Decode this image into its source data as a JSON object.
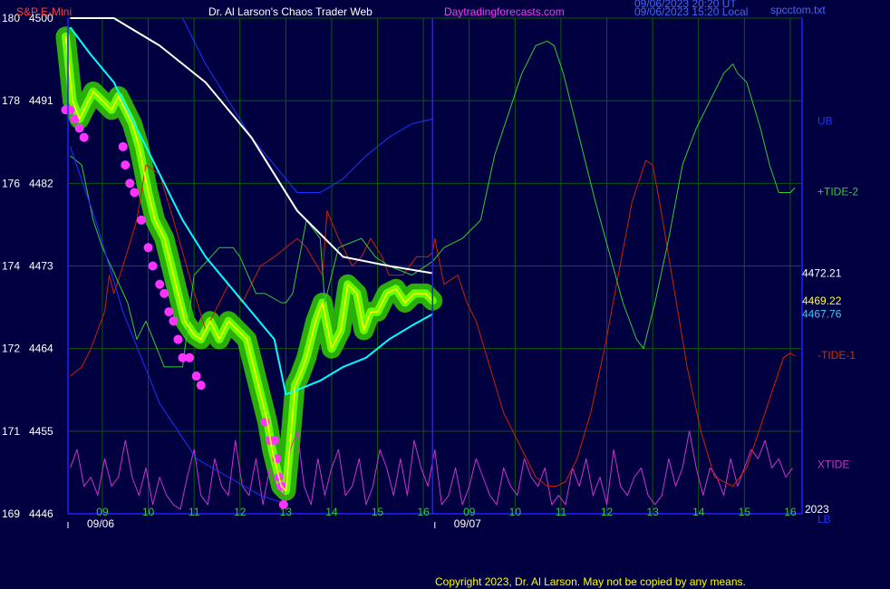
{
  "header": {
    "title_left": "S&P E-Mini",
    "title_center": "Dr. Al Larson's Chaos Trader Web",
    "title_site": "Daytradingforecasts.com",
    "timestamp_1": "09/06/2023 20:20 UT",
    "timestamp_2": "09/06/2023 15:20 Local",
    "file_name": "spcctom.txt"
  },
  "footer": {
    "copyright": "Copyright 2023, Dr. Al Larson. May not be copied by any means.",
    "year": "2023"
  },
  "colors": {
    "background": "#000040",
    "grid": "#0a5a0a",
    "axis": "#2020ff",
    "price": "#ffff00",
    "bands": "#00ffff",
    "glow": "#33cc00",
    "dots": "#ff33ff",
    "tide_plus": "#33cc33",
    "tide_minus": "#cc2200",
    "xtide": "#cc33cc",
    "ma_white": "#ffffff",
    "upper_band": "#1a33ff"
  },
  "chart_data": {
    "type": "line",
    "title": "S&P E-Mini",
    "y_axis": {
      "ticks": [
        {
          "left": "180",
          "right": "4500",
          "value": 4500
        },
        {
          "left": "178",
          "right": "4491",
          "value": 4491
        },
        {
          "left": "176",
          "right": "4482",
          "value": 4482
        },
        {
          "left": "174",
          "right": "4473",
          "value": 4473
        },
        {
          "left": "172",
          "right": "4464",
          "value": 4464
        },
        {
          "left": "171",
          "right": "4455",
          "value": 4455
        },
        {
          "left": "169",
          "right": "4446",
          "value": 4446
        }
      ],
      "ylim": [
        4446,
        4500
      ]
    },
    "x_axis": {
      "hour_ticks": [
        {
          "label": "09",
          "t": 0.75
        },
        {
          "label": "10",
          "t": 1.75
        },
        {
          "label": "11",
          "t": 2.75
        },
        {
          "label": "12",
          "t": 3.75
        },
        {
          "label": "13",
          "t": 4.75
        },
        {
          "label": "14",
          "t": 5.75
        },
        {
          "label": "15",
          "t": 6.75
        },
        {
          "label": "16",
          "t": 7.75
        },
        {
          "label": "09",
          "t": 8.75
        },
        {
          "label": "10",
          "t": 9.75
        },
        {
          "label": "11",
          "t": 10.75
        },
        {
          "label": "12",
          "t": 11.75
        },
        {
          "label": "13",
          "t": 12.75
        },
        {
          "label": "14",
          "t": 13.75
        },
        {
          "label": "15",
          "t": 14.75
        },
        {
          "label": "16",
          "t": 15.75
        }
      ],
      "date_labels": [
        {
          "label": "09/06",
          "t": 0
        },
        {
          "label": "09/07",
          "t": 8
        }
      ],
      "xlim": [
        0,
        15.85
      ],
      "now_t": 7.95
    },
    "value_labels": [
      {
        "text": "4472.21",
        "value": 4472.21,
        "color": "#ffffff"
      },
      {
        "text": "4469.22",
        "value": 4469.22,
        "color": "#ffff33"
      },
      {
        "text": "4467.76",
        "value": 4467.76,
        "color": "#33ccff"
      }
    ],
    "series_labels": [
      {
        "text": "UB",
        "value": 4488.8,
        "color": "#2233ff"
      },
      {
        "text": "+TIDE-2",
        "value": 4481.1,
        "color": "#33cc33"
      },
      {
        "text": "-TIDE-1",
        "value": 4463.3,
        "color": "#cc3300"
      },
      {
        "text": "XTIDE",
        "value": 4451.4,
        "color": "#cc33cc"
      },
      {
        "text": "LB",
        "value": 4445.4,
        "color": "#2233ff"
      }
    ],
    "series": [
      {
        "name": "Price",
        "color": "#ffff00",
        "glow": true,
        "t": [
          -0.05,
          0.1,
          0.25,
          0.4,
          0.55,
          0.75,
          0.95,
          1.1,
          1.25,
          1.4,
          1.55,
          1.75,
          1.9,
          2.0,
          2.1,
          2.25,
          2.4,
          2.55,
          2.75,
          2.9,
          3.1,
          3.3,
          3.5,
          3.7,
          3.9,
          4.05,
          4.2,
          4.35,
          4.45,
          4.55,
          4.65,
          4.75,
          4.85,
          4.95,
          5.05,
          5.2,
          5.4,
          5.55,
          5.75,
          5.95,
          6.1,
          6.3,
          6.45,
          6.6,
          6.75,
          6.95,
          7.15,
          7.35,
          7.55,
          7.8,
          7.95
        ],
        "y": [
          4498,
          4491,
          4489,
          4490.5,
          4492,
          4491,
          4490,
          4491.5,
          4490,
          4488.5,
          4486,
          4481,
          4478,
          4477,
          4476,
          4473,
          4470,
          4467,
          4465.5,
          4465,
          4467,
          4465,
          4467,
          4466,
          4465,
          4462,
          4459,
          4456,
          4453,
          4451,
          4449,
          4448.5,
          4454,
          4460,
          4461,
          4463,
          4467,
          4469,
          4464,
          4466,
          4471,
          4470,
          4466,
          4468,
          4468,
          4470,
          4470.5,
          4469,
          4470,
          4470,
          4469.22
        ]
      },
      {
        "name": "Band Average",
        "color": "#00ffff",
        "t": [
          0.05,
          0.5,
          1.0,
          1.5,
          2.0,
          2.5,
          3.0,
          3.5,
          4.0,
          4.5,
          4.75,
          5.0,
          5.5,
          6.0,
          6.5,
          7.0,
          7.5,
          7.95
        ],
        "y": [
          4499,
          4496,
          4493,
          4488,
          4483,
          4478,
          4474,
          4471,
          4468,
          4465,
          4459,
          4459.5,
          4460.5,
          4462,
          4463,
          4465,
          4466.5,
          4467.76
        ]
      },
      {
        "name": "MA",
        "color": "#ffffff",
        "t": [
          0.05,
          1.0,
          2.0,
          3.0,
          4.0,
          5.0,
          6.0,
          7.0,
          7.95
        ],
        "y": [
          4500,
          4500,
          4497,
          4493,
          4487,
          4479,
          4474,
          4473,
          4472.21
        ]
      },
      {
        "name": "UB",
        "color": "#1a33ff",
        "t": [
          2.5,
          3.0,
          3.5,
          4.0,
          4.5,
          5.0,
          5.5,
          6.0,
          6.5,
          7.0,
          7.5,
          7.95
        ],
        "y": [
          4500,
          4495,
          4491,
          4487,
          4484,
          4481,
          4481,
          4482.5,
          4485,
          4487,
          4488.5,
          4489
        ]
      },
      {
        "name": "LB",
        "color": "#1a33ff",
        "t": [
          0.05,
          0.6,
          1.2,
          2.0,
          2.8,
          3.5,
          4.2,
          4.8
        ],
        "y": [
          4486,
          4478,
          4468,
          4458,
          4452,
          4450,
          4448,
          4447
        ]
      },
      {
        "name": "+TIDE-2",
        "color": "#33cc33",
        "t": [
          0.05,
          0.3,
          0.55,
          0.75,
          1.3,
          1.5,
          1.7,
          2.1,
          2.3,
          2.5,
          2.75,
          3.3,
          3.6,
          3.75,
          4.1,
          4.3,
          4.65,
          4.75,
          4.9,
          5.2,
          5.5,
          5.6,
          5.9,
          6.4,
          6.7,
          7.0,
          7.5,
          7.8,
          7.95,
          8.2,
          8.6,
          9.0,
          9.3,
          9.9,
          10.2,
          10.45,
          10.6,
          10.8,
          11.0,
          11.2,
          11.5,
          12.1,
          12.4,
          12.55,
          12.8,
          13.1,
          13.4,
          13.7,
          13.9,
          14.1,
          14.3,
          14.5,
          14.6,
          14.8,
          15.1,
          15.3,
          15.5,
          15.75,
          15.85
        ],
        "y": [
          4485,
          4484,
          4478,
          4475,
          4469,
          4465,
          4467,
          4462,
          4462,
          4462,
          4472,
          4475,
          4475,
          4474,
          4470,
          4470,
          4469,
          4469,
          4470,
          4478,
          4476,
          4469,
          4475,
          4476,
          4474,
          4473,
          4472,
          4473,
          4473.5,
          4475,
          4476,
          4478,
          4485,
          4494,
          4497,
          4497.5,
          4497,
          4494,
          4490,
          4486,
          4480,
          4469,
          4465,
          4464,
          4469,
          4476,
          4484,
          4488,
          4490,
          4492,
          4494,
          4495,
          4494,
          4493,
          4488,
          4484,
          4481,
          4481,
          4481.5
        ]
      },
      {
        "name": "-TIDE-1",
        "color": "#cc2200",
        "t": [
          0.05,
          0.3,
          0.5,
          0.8,
          0.9,
          1.0,
          1.2,
          1.5,
          1.7,
          2.0,
          2.3,
          2.7,
          3.0,
          3.5,
          3.8,
          4.2,
          4.5,
          5.0,
          5.2,
          5.55,
          5.65,
          5.9,
          6.2,
          6.4,
          6.6,
          6.85,
          7.0,
          7.3,
          7.6,
          7.85,
          7.95,
          8.0,
          8.2,
          8.5,
          8.7,
          8.9,
          9.2,
          9.5,
          9.9,
          10.2,
          10.45,
          10.65,
          10.85,
          11.1,
          11.4,
          11.7,
          12.0,
          12.3,
          12.6,
          12.75,
          12.9,
          13.2,
          13.5,
          13.8,
          14.1,
          14.5,
          14.8,
          15.0,
          15.2,
          15.4,
          15.6,
          15.75,
          15.85
        ],
        "y": [
          4461,
          4462,
          4464,
          4468,
          4472,
          4470,
          4473,
          4478,
          4484,
          4483,
          4478,
          4471,
          4466,
          4471,
          4469,
          4473,
          4474,
          4476,
          4475,
          4472,
          4479,
          4476,
          4473,
          4474,
          4476,
          4474,
          4472,
          4472,
          4474,
          4474,
          4474.5,
          4476,
          4471,
          4472,
          4469,
          4467,
          4462,
          4457,
          4453,
          4450,
          4449,
          4449,
          4449.5,
          4452,
          4457,
          4464,
          4472,
          4480,
          4484.5,
          4484,
          4480,
          4471,
          4462,
          4455,
          4450,
          4449,
          4451,
          4454,
          4457,
          4460,
          4463,
          4463.5,
          4463.2
        ]
      },
      {
        "name": "XTIDE",
        "color": "#cc33cc",
        "t": [
          0.05,
          0.2,
          0.35,
          0.5,
          0.65,
          0.8,
          0.95,
          1.1,
          1.25,
          1.4,
          1.55,
          1.7,
          1.85,
          2.0,
          2.15,
          2.3,
          2.45,
          2.6,
          2.75,
          2.9,
          3.05,
          3.2,
          3.35,
          3.5,
          3.65,
          3.8,
          3.95,
          4.1,
          4.25,
          4.4,
          4.55,
          4.7,
          4.85,
          5.0,
          5.15,
          5.3,
          5.45,
          5.6,
          5.75,
          5.9,
          6.05,
          6.2,
          6.35,
          6.5,
          6.65,
          6.8,
          6.95,
          7.1,
          7.25,
          7.4,
          7.55,
          7.7,
          7.85,
          8.0,
          8.15,
          8.3,
          8.45,
          8.6,
          8.75,
          8.9,
          9.05,
          9.2,
          9.35,
          9.5,
          9.65,
          9.8,
          9.95,
          10.1,
          10.25,
          10.4,
          10.55,
          10.7,
          10.85,
          11.0,
          11.15,
          11.3,
          11.45,
          11.6,
          11.75,
          11.9,
          12.05,
          12.2,
          12.35,
          12.5,
          12.65,
          12.8,
          12.95,
          13.1,
          13.25,
          13.4,
          13.55,
          13.7,
          13.85,
          14.0,
          14.15,
          14.3,
          14.45,
          14.6,
          14.75,
          14.9,
          15.05,
          15.2,
          15.35,
          15.5,
          15.65,
          15.8
        ],
        "y": [
          4451,
          4453,
          4449,
          4450,
          4448,
          4452,
          4449,
          4450,
          4454,
          4450,
          4448,
          4451,
          4447,
          4450,
          4448,
          4447,
          4446.5,
          4450,
          4453,
          4448,
          4447,
          4452,
          4449,
          4448,
          4454,
          4449,
          4448,
          4452,
          4447,
          4451,
          4449,
          4448,
          4453,
          4455,
          4449,
          4447,
          4452,
          4448,
          4451,
          4453,
          4448,
          4449,
          4452,
          4447,
          4449,
          4453,
          4451,
          4448,
          4452,
          4448,
          4454,
          4451,
          4449,
          4453,
          4447,
          4448,
          4451,
          4447,
          4449,
          4452,
          4450,
          4448,
          4447,
          4451,
          4449,
          4448,
          4452,
          4450,
          4449,
          4451,
          4447,
          4448,
          4447,
          4451,
          4449,
          4452,
          4448,
          4450,
          4447,
          4453,
          4449,
          4448,
          4450,
          4451,
          4448,
          4447,
          4448,
          4452,
          4449,
          4451,
          4455,
          4451,
          4448,
          4451,
          4450,
          4448,
          4452,
          4449,
          4451,
          4453,
          4452,
          4454,
          4451,
          4452,
          4450,
          4451
        ]
      },
      {
        "name": "Chaos Dots",
        "color": "#ff33ff",
        "kind": "dots",
        "t": [
          -0.05,
          0.05,
          0.15,
          0.25,
          0.35,
          1.2,
          1.25,
          1.35,
          1.45,
          1.6,
          1.75,
          1.85,
          2.0,
          2.1,
          2.2,
          2.3,
          2.4,
          2.5,
          2.65,
          2.8,
          2.9,
          4.3,
          4.4,
          4.5,
          4.55,
          4.6,
          4.65,
          4.7
        ],
        "y": [
          4490,
          4490,
          4489,
          4488,
          4487,
          4486,
          4484,
          4482,
          4481,
          4478,
          4475,
          4473,
          4471,
          4470,
          4468,
          4467,
          4465,
          4463,
          4463,
          4461,
          4460,
          4456,
          4454,
          4454,
          4452,
          4450,
          4449,
          4447
        ]
      }
    ]
  }
}
